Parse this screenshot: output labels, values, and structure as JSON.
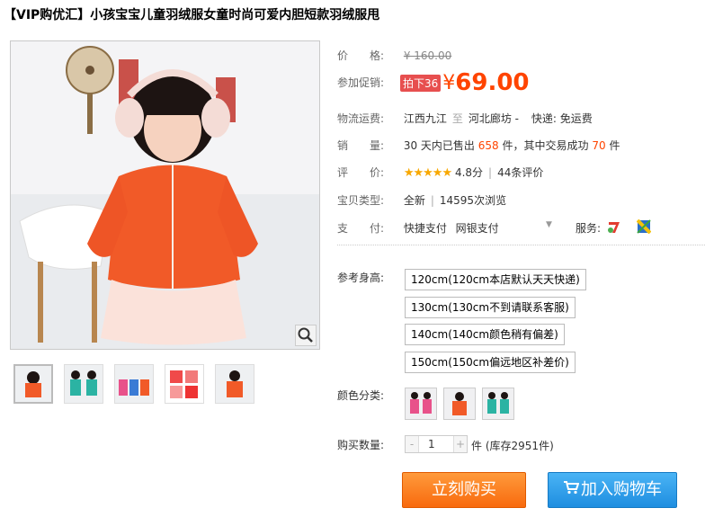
{
  "title": "【VIP购优汇】小孩宝宝儿童羽绒服女童时尚可爱内胆短款羽绒服甩",
  "price": {
    "label": "价　　格:",
    "original": "¥ 160.00",
    "promo_label": "参加促销:",
    "promo_tag": "拍下36",
    "currency": "¥",
    "value": "69.00"
  },
  "shipping": {
    "label": "物流运费:",
    "from": "江西九江",
    "sep": "至",
    "to": "河北廊坊 -",
    "method": "快递: 免运费"
  },
  "sales": {
    "label": "销　　量:",
    "prefix": "30 天内已售出",
    "count": "658",
    "mid": "件，其中交易成功",
    "success": "70",
    "suffix": "件"
  },
  "rating": {
    "label": "评　　价:",
    "stars": "★★★★★",
    "score": "4.8分",
    "reviews": "44条评价"
  },
  "type": {
    "label": "宝贝类型:",
    "condition": "全新",
    "views": "14595次浏览"
  },
  "payment": {
    "label": "支　　付:",
    "method1": "快捷支付",
    "method2": "网银支付",
    "service_label": "服务:"
  },
  "sizes": {
    "label": "参考身高:",
    "options": [
      "120cm(120cm本店默认天天快递)",
      "130cm(130cm不到请联系客服)",
      "140cm(140cm颜色稍有偏差)",
      "150cm(150cm偏远地区补差价)"
    ]
  },
  "colors": {
    "label": "颜色分类:"
  },
  "quantity": {
    "label": "购买数量:",
    "minus": "-",
    "value": "1",
    "plus": "+",
    "unit": "件",
    "stock": "(库存2951件)"
  },
  "buttons": {
    "buy": "立刻购买",
    "cart": "加入购物车"
  },
  "colors_theme": {
    "price": "#ff4400",
    "buy_button": "#f86a0e",
    "cart_button": "#1e8ee0",
    "promo_tag": "#e74f4f"
  }
}
